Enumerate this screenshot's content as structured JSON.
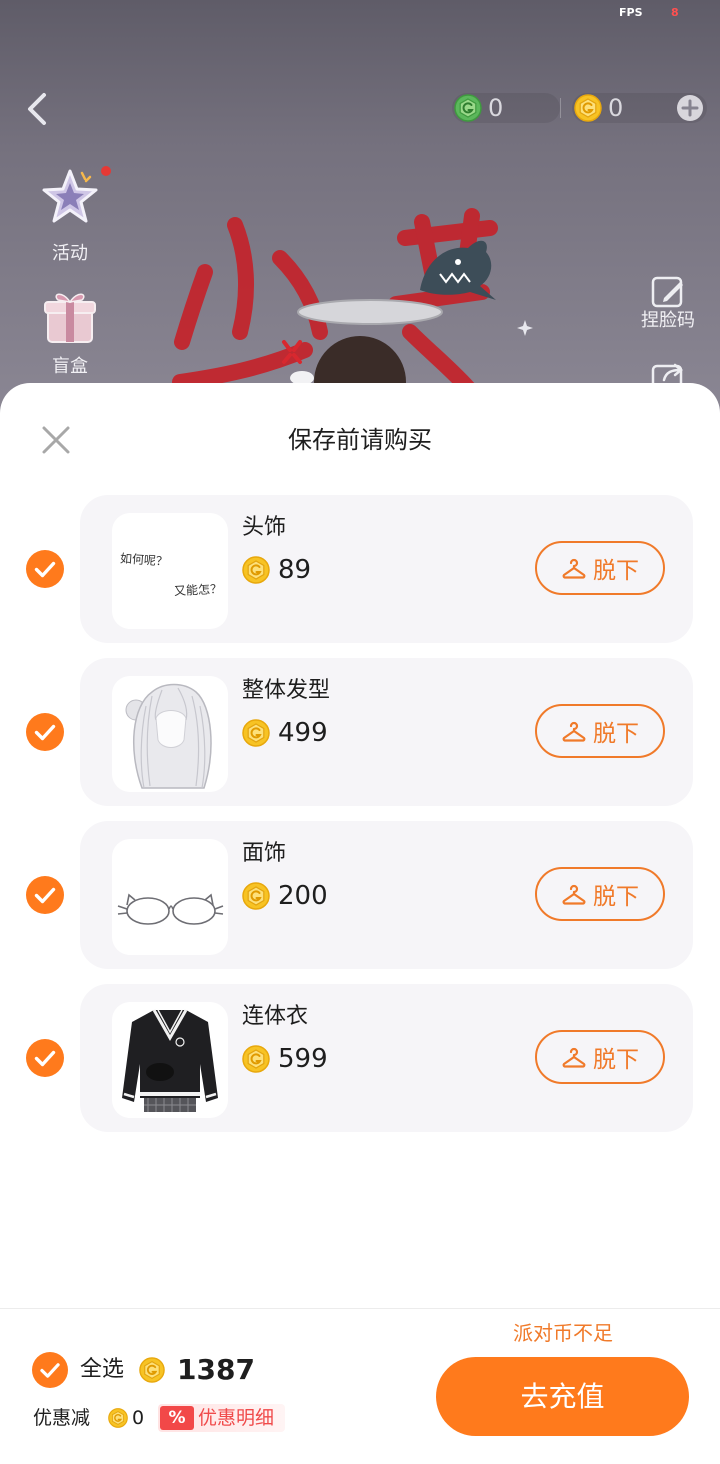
{
  "status": {
    "fps_label": "FPS",
    "fps_value": "8"
  },
  "top_bar": {
    "green_coin_value": "0",
    "gold_coin_value": "0",
    "icons": {
      "back": "chevron-left-icon",
      "green_coin": "green-coin-icon",
      "gold_coin": "gold-coin-icon",
      "add": "plus-circle-icon"
    }
  },
  "left_menu": [
    {
      "label": "活动",
      "icon": "star-icon",
      "has_dot": true
    },
    {
      "label": "盲盒",
      "icon": "gift-icon",
      "has_dot": false
    }
  ],
  "right_menu": [
    {
      "label": "捏脸码",
      "icon": "edit-code-icon"
    },
    {
      "label": "",
      "icon": "share-icon"
    }
  ],
  "sheet": {
    "title": "保存前请购买",
    "items": [
      {
        "name": "头饰",
        "price": "89",
        "button": "脱下",
        "checked": true,
        "thumb_text": [
          "如何呢？",
          "又能怎？"
        ]
      },
      {
        "name": "整体发型",
        "price": "499",
        "button": "脱下",
        "checked": true
      },
      {
        "name": "面饰",
        "price": "200",
        "button": "脱下",
        "checked": true
      },
      {
        "name": "连体衣",
        "price": "599",
        "button": "脱下",
        "checked": true
      }
    ]
  },
  "footer": {
    "warning": "派对币不足",
    "select_all": "全选",
    "select_all_checked": true,
    "total": "1387",
    "discount_label": "优惠减",
    "discount_value": "0",
    "discount_badge": "%",
    "discount_detail": "优惠明细",
    "recharge_button": "去充值"
  },
  "colors": {
    "accent": "#ff7a1c",
    "outline": "#f07a2a",
    "coin": "#f7c324",
    "green_coin": "#5cb85c",
    "discount_red": "#f04a4a",
    "card_bg": "#f6f5f8"
  }
}
